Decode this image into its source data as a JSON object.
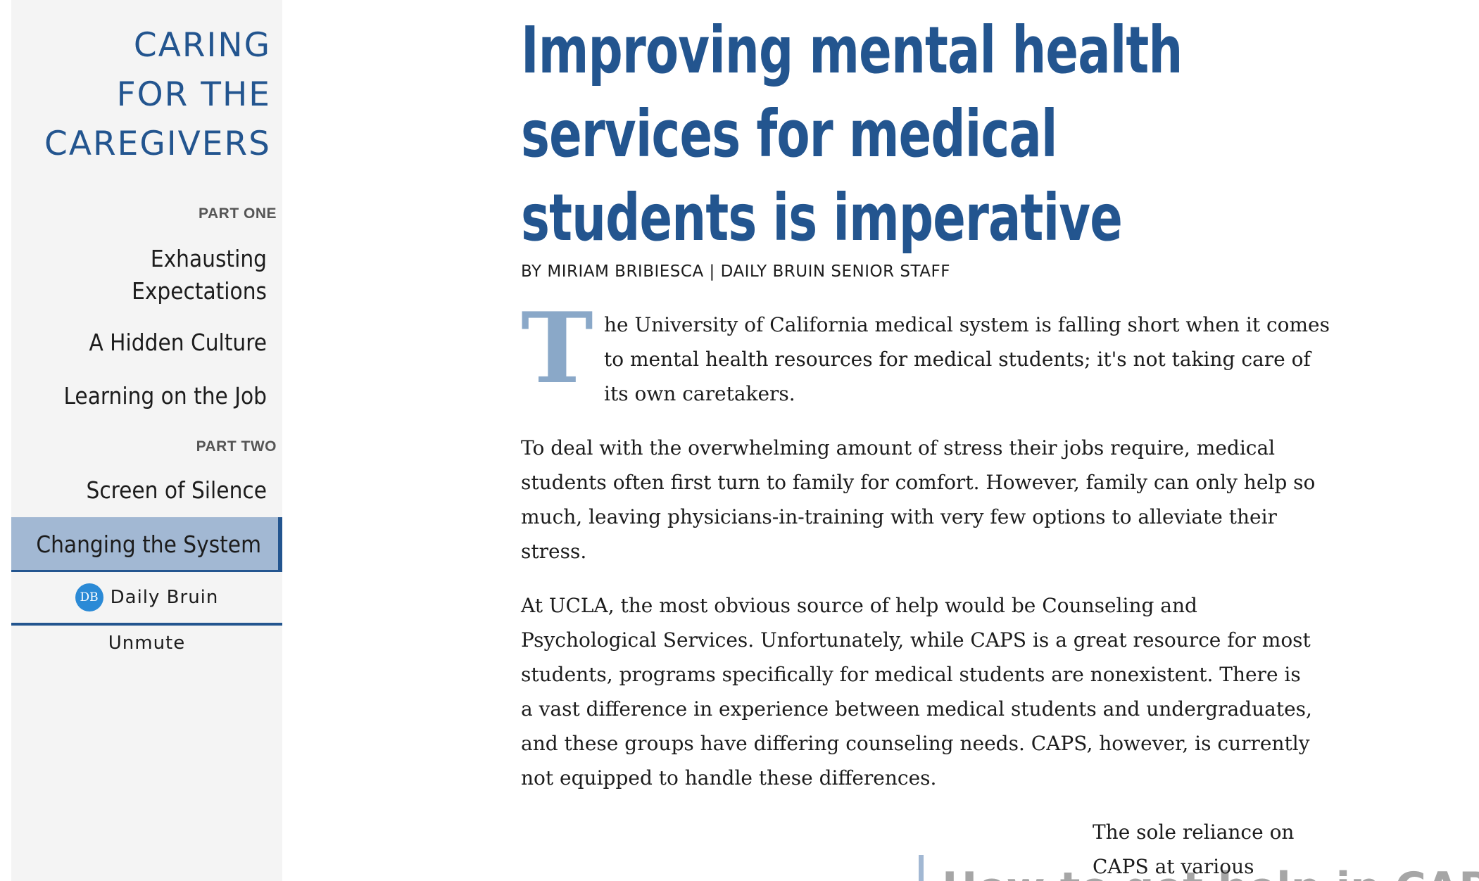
{
  "sidebar": {
    "site_title": [
      "CARING",
      "FOR THE",
      "CAREGIVERS"
    ],
    "part_one_label": "PART ONE",
    "part_two_label": "PART TWO",
    "items": {
      "exhausting": "Exhausting Expectations",
      "hidden_culture": "A Hidden Culture",
      "learning": "Learning on the Job",
      "screen_silence": "Screen of Silence",
      "changing_system": "Changing the System"
    },
    "active_item": "Changing the System",
    "brand": {
      "logo_text": "DB",
      "name": "Daily Bruin"
    },
    "mute_label": "Unmute"
  },
  "article": {
    "headline": "Improving mental health services for medical students is imperative",
    "byline": "BY MIRIAM BRIBIESCA | DAILY BRUIN SENIOR STAFF",
    "dropcap": "T",
    "paragraph_1": "he University of California medical system is falling short when it comes to mental health resources for medical students; it's not taking care of its own caretakers.",
    "paragraph_2": "To deal with the overwhelming amount of stress their jobs require, medical students often first turn to family for comfort. However, family can only help so much, leaving physicians-in-training with very few options to alleviate their stress.",
    "paragraph_3": "At UCLA, the most obvious source of help would be Counseling and Psychological Services. Unfortunately, while CAPS is a great resource for most students, programs specifically for medical students are nonexistent. There is a vast difference in experience between medical students and undergraduates, and these groups have differing counseling needs. CAPS, however, is currently not equipped to handle these differences.",
    "paragraph_4": "The sole reliance on CAPS at various",
    "pull_heading": "How to get help in CAPS"
  },
  "colors": {
    "accent": "#23558f",
    "active_bg": "#a2b8d3",
    "dropcap": "#8aa8c8",
    "sidebar_bg": "#f4f4f4"
  }
}
